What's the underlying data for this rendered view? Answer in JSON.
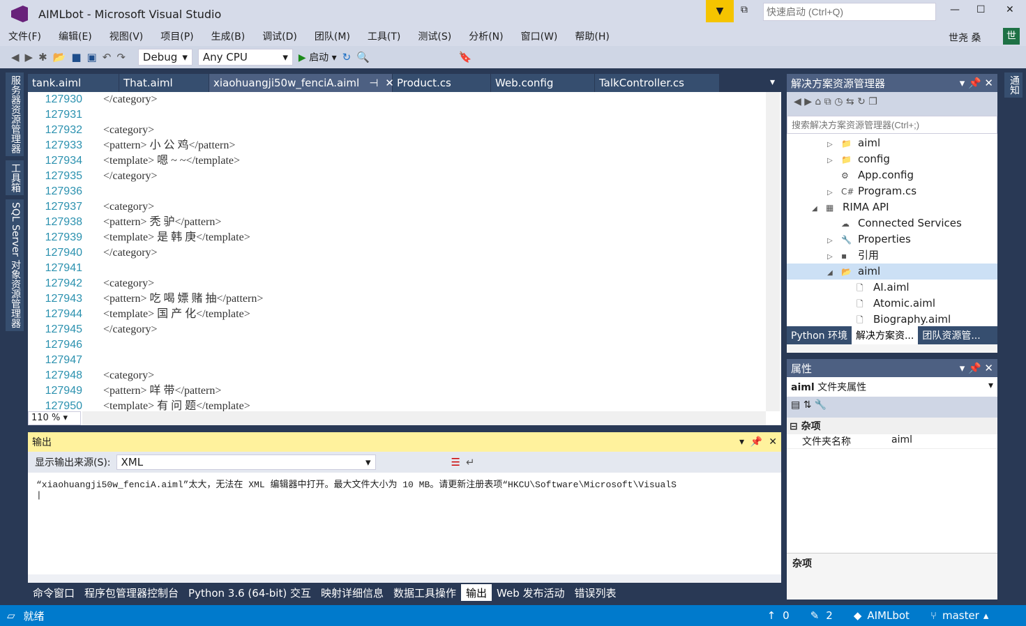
{
  "window": {
    "title": "AIMLbot - Microsoft Visual Studio",
    "quick_launch_placeholder": "快速启动 (Ctrl+Q)",
    "user": "世尧 桑",
    "avatar": "世"
  },
  "menu": [
    "文件(F)",
    "编辑(E)",
    "视图(V)",
    "项目(P)",
    "生成(B)",
    "调试(D)",
    "团队(M)",
    "工具(T)",
    "测试(S)",
    "分析(N)",
    "窗口(W)",
    "帮助(H)"
  ],
  "toolbar": {
    "config": "Debug",
    "platform": "Any CPU",
    "start": "启动"
  },
  "left_tabs": [
    "服务器资源管理器",
    "工具箱",
    "SQL Server 对象资源管理器"
  ],
  "right_tabs": [
    "通知"
  ],
  "editor_tabs": [
    {
      "label": "tank.aiml"
    },
    {
      "label": "That.aiml"
    },
    {
      "label": "xiaohuangji50w_fenciA.aiml",
      "active": true
    },
    {
      "label": "Product.cs"
    },
    {
      "label": "Web.config"
    },
    {
      "label": "TalkController.cs"
    }
  ],
  "editor": {
    "zoom": "110 %",
    "lines": [
      {
        "n": "127930",
        "t": "</category>"
      },
      {
        "n": "127931",
        "t": ""
      },
      {
        "n": "127932",
        "t": "<category>"
      },
      {
        "n": "127933",
        "t": "<pattern> 小 公 鸡</pattern>"
      },
      {
        "n": "127934",
        "t": "<template> 嗯 ~ ~</template>"
      },
      {
        "n": "127935",
        "t": "</category>"
      },
      {
        "n": "127936",
        "t": ""
      },
      {
        "n": "127937",
        "t": "<category>"
      },
      {
        "n": "127938",
        "t": "<pattern> 秃 驴</pattern>"
      },
      {
        "n": "127939",
        "t": "<template> 是 韩 庚</template>"
      },
      {
        "n": "127940",
        "t": "</category>"
      },
      {
        "n": "127941",
        "t": ""
      },
      {
        "n": "127942",
        "t": "<category>"
      },
      {
        "n": "127943",
        "t": "<pattern> 吃 喝 嫖 赌 抽</pattern>"
      },
      {
        "n": "127944",
        "t": "<template> 国 产 化</template>"
      },
      {
        "n": "127945",
        "t": "</category>"
      },
      {
        "n": "127946",
        "t": ""
      },
      {
        "n": "127947",
        "t": ""
      },
      {
        "n": "127948",
        "t": "<category>"
      },
      {
        "n": "127949",
        "t": "<pattern> 咩 带</pattern>"
      },
      {
        "n": "127950",
        "t": "<template> 有 问 题</template>"
      }
    ]
  },
  "output": {
    "title": "输出",
    "source_label": "显示输出来源(S):",
    "source": "XML",
    "text": "“xiaohuangji50w_fenciA.aiml”太大，无法在 XML 编辑器中打开。最大文件大小为 10 MB。请更新注册表项“HKCU\\Software\\Microsoft\\VisualS"
  },
  "bottom_tabs": [
    {
      "label": "命令窗口"
    },
    {
      "label": "程序包管理器控制台"
    },
    {
      "label": "Python 3.6 (64-bit) 交互"
    },
    {
      "label": "映射详细信息"
    },
    {
      "label": "数据工具操作"
    },
    {
      "label": "输出",
      "active": true
    },
    {
      "label": "Web 发布活动"
    },
    {
      "label": "错误列表"
    }
  ],
  "solution": {
    "title": "解决方案资源管理器",
    "search_placeholder": "搜索解决方案资源管理器(Ctrl+;)",
    "items": [
      {
        "label": "aiml",
        "indent": 1,
        "icon": "folder"
      },
      {
        "label": "config",
        "indent": 1,
        "icon": "folder"
      },
      {
        "label": "App.config",
        "indent": 1,
        "icon": "config-file"
      },
      {
        "label": "Program.cs",
        "indent": 1,
        "icon": "csharp-file"
      },
      {
        "label": "RIMA API",
        "indent": 0,
        "icon": "web-project"
      },
      {
        "label": "Connected Services",
        "indent": 1,
        "icon": "cloud"
      },
      {
        "label": "Properties",
        "indent": 1,
        "icon": "wrench"
      },
      {
        "label": "引用",
        "indent": 1,
        "icon": "references"
      },
      {
        "label": "aiml",
        "indent": 1,
        "icon": "folder-open",
        "selected": true
      },
      {
        "label": "AI.aiml",
        "indent": 2,
        "icon": "file"
      },
      {
        "label": "Atomic.aiml",
        "indent": 2,
        "icon": "file"
      },
      {
        "label": "Biography.aiml",
        "indent": 2,
        "icon": "file"
      }
    ],
    "tabs": [
      {
        "label": "Python 环境"
      },
      {
        "label": "解决方案资...",
        "active": true
      },
      {
        "label": "团队资源管..."
      }
    ]
  },
  "properties": {
    "title": "属性",
    "object": "aiml",
    "object_type": "文件夹属性",
    "category": "杂项",
    "rows": [
      {
        "name": "文件夹名称",
        "value": "aiml"
      }
    ],
    "description_title": "杂项"
  },
  "status": {
    "text": "就绪",
    "up": "0",
    "pending": "2",
    "repo": "AIMLbot",
    "branch": "master"
  },
  "colors": {
    "accent": "#007acc",
    "dark": "#293955",
    "output_header": "#fff29d"
  }
}
